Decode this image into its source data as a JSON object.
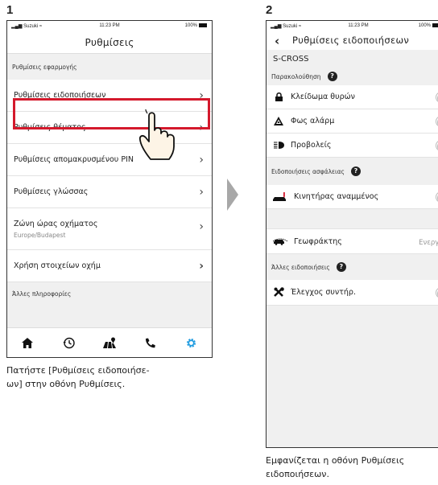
{
  "steps": {
    "one": "1",
    "two": "2"
  },
  "status": {
    "carrier": "Suzuki",
    "time": "11:23 PM",
    "battery": "100%"
  },
  "screen1": {
    "title": "Ρυθμίσεις",
    "section_app": "Ρυθμίσεις εφαρμογής",
    "items": [
      {
        "label": "Ρυθμίσεις ειδοποιήσεων"
      },
      {
        "label": "Ρυθμίσεις θέματος"
      },
      {
        "label": "Ρυθμίσεις απομακρυσμένου PIN"
      },
      {
        "label": "Ρυθμίσεις γλώσσας"
      },
      {
        "label": "Ζώνη ώρας οχήματος",
        "sub": "Europe/Budapest"
      },
      {
        "label": "Χρήση στοιχείων οχήμ"
      }
    ],
    "section_other": "Άλλες πληροφορίες",
    "caption": [
      "Πατήστε [Ρυθμίσεις ειδοποιήσε-",
      "ων] στην οθόνη Ρυθμίσεις."
    ]
  },
  "screen2": {
    "title": "Ρυθμίσεις ειδοποιήσεων",
    "vehicle": "S-CROSS",
    "section_monitor": "Παρακολούθηση",
    "monitor_items": [
      "Κλείδωμα θυρών",
      "Φως αλάρμ",
      "Προβολείς"
    ],
    "section_security": "Ειδοποιήσεις ασφάλειας",
    "immobilizer": "Κινητήρας αναμμένος",
    "geofence": "Γεωφράκτης",
    "geofence_status": "Ενεργός",
    "section_other": "Άλλες ειδοποιήσεις",
    "maintenance": "Έλεγχος συντήρ.",
    "caption": [
      "Εμφανίζεται η οθόνη Ρυθμίσεις",
      "ειδοποιήσεων."
    ]
  },
  "help_mark": "?",
  "colors": {
    "highlight": "#d4192c",
    "settings_tab": "#1e9be0"
  },
  "icons": {
    "tabs": [
      "home-icon",
      "history-icon",
      "map-icon",
      "phone-icon",
      "gear-icon"
    ],
    "rows": [
      "lock-icon",
      "hazard-icon",
      "headlight-icon",
      "car-engine-icon",
      "geofence-car-icon",
      "wrench-icon"
    ]
  }
}
